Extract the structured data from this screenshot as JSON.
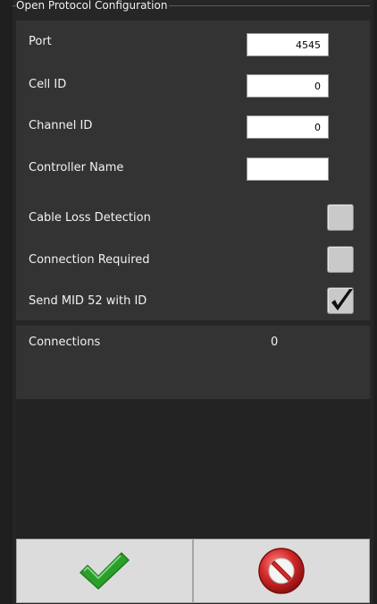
{
  "window": {
    "title": "Open Protocol Configuration"
  },
  "settings": {
    "port": {
      "label": "Port",
      "value": "4545"
    },
    "cell_id": {
      "label": "Cell ID",
      "value": "0"
    },
    "channel_id": {
      "label": "Channel ID",
      "value": "0"
    },
    "controller_name": {
      "label": "Controller Name",
      "value": ""
    },
    "cable_loss_detection": {
      "label": "Cable Loss Detection",
      "checked": false
    },
    "connection_required": {
      "label": "Connection Required",
      "checked": false
    },
    "send_mid52": {
      "label": "Send MID 52 with ID",
      "checked": true
    }
  },
  "connections": {
    "label": "Connections",
    "value": "0"
  },
  "buttons": {
    "ok_icon": "checkmark-icon",
    "cancel_icon": "no-entry-icon"
  },
  "colors": {
    "ok_green": "#2aa02a",
    "cancel_red": "#d42a2a"
  }
}
